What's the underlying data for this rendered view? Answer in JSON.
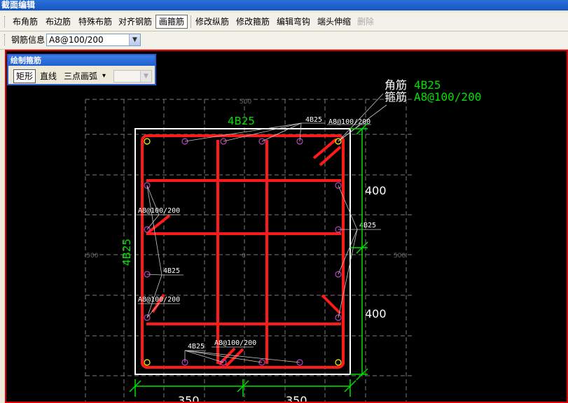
{
  "window": {
    "title": "截面编辑"
  },
  "toolbar": {
    "items": [
      {
        "label": "布角筋",
        "active": false,
        "enabled": true
      },
      {
        "label": "布边筋",
        "active": false,
        "enabled": true
      },
      {
        "label": "特殊布筋",
        "active": false,
        "enabled": true
      },
      {
        "label": "对齐钢筋",
        "active": false,
        "enabled": true
      },
      {
        "label": "画箍筋",
        "active": true,
        "enabled": true
      },
      {
        "label": "修改纵筋",
        "active": false,
        "enabled": true
      },
      {
        "label": "修改箍筋",
        "active": false,
        "enabled": true
      },
      {
        "label": "编辑弯钩",
        "active": false,
        "enabled": true
      },
      {
        "label": "端头伸缩",
        "active": false,
        "enabled": true
      },
      {
        "label": "删除",
        "active": false,
        "enabled": false
      }
    ]
  },
  "rebar_info": {
    "label": "钢筋信息",
    "value": "A8@100/200"
  },
  "draw_panel": {
    "title": "绘制箍筋",
    "rect_label": "矩形",
    "line_label": "直线",
    "arc_label": "三点画弧",
    "arc_dropdown": "▾",
    "arc_select_value": ""
  },
  "drawing": {
    "legend": {
      "corner_label": "角筋",
      "corner_value": "4B25",
      "stirrup_label": "箍筋",
      "stirrup_value": "A8@100/200"
    },
    "top_dim_label": "4B25",
    "left_dim_label": "4B25",
    "right_dims": [
      "400",
      "400"
    ],
    "bottom_dims": [
      "350",
      "350"
    ],
    "grid_labels": {
      "top": "500",
      "left": "-500",
      "right": "500",
      "center": "0"
    },
    "callouts": {
      "top_bars": "4B25",
      "top_stirrup": "A8@100/200",
      "right_bars": "4B25",
      "left_stirrup_1": "A8@100/200",
      "left_bars": "4B25",
      "left_stirrup_2": "A8@100/200",
      "bottom_bars": "4B25",
      "bottom_stirrup": "A8@100/200"
    },
    "colors": {
      "background": "#000000",
      "stirrup": "#ff1a1a",
      "dimension": "#00e000",
      "outline": "#ffffff",
      "rebar": "#c040c0",
      "corner_rebar": "#ffff00",
      "grid": "#7a7a7a"
    }
  }
}
